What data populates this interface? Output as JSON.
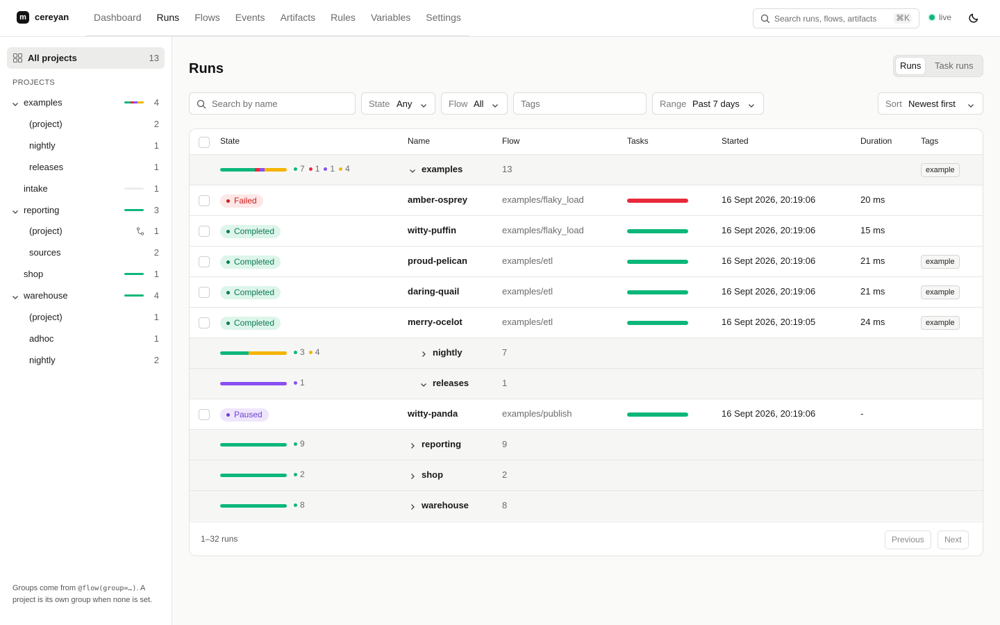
{
  "header": {
    "logo_glyph": "m",
    "brand": "cereyan",
    "nav": [
      {
        "label": "Dashboard"
      },
      {
        "label": "Runs",
        "active": true
      },
      {
        "label": "Flows"
      },
      {
        "label": "Events"
      },
      {
        "label": "Artifacts"
      },
      {
        "label": "Rules"
      },
      {
        "label": "Variables"
      },
      {
        "label": "Settings"
      }
    ],
    "search_placeholder": "Search runs, flows, artifacts",
    "search_shortcut": "⌘K",
    "live_label": "live",
    "theme_icon": "moon-icon"
  },
  "sidebar": {
    "all_projects": {
      "label": "All projects",
      "count": "13",
      "icon": "grid-icon"
    },
    "section_title": "PROJECTS",
    "tree": [
      {
        "id": "examples",
        "name": "examples",
        "count": "4",
        "level": 0,
        "expanded": true,
        "mini_bar": [
          {
            "color": "#0cb77a",
            "w": 9
          },
          {
            "color": "#e8293a",
            "w": 5
          },
          {
            "color": "#8a4ff0",
            "w": 5
          },
          {
            "color": "#f5b400",
            "w": 9
          }
        ]
      },
      {
        "id": "examples-project",
        "name": "(project)",
        "count": "2",
        "level": 1
      },
      {
        "id": "examples-nightly",
        "name": "nightly",
        "count": "1",
        "level": 1
      },
      {
        "id": "examples-releases",
        "name": "releases",
        "count": "1",
        "level": 1
      },
      {
        "id": "intake",
        "name": "intake",
        "count": "1",
        "level": 0,
        "mini_bar": [
          {
            "color": "#ececec",
            "w": 28
          }
        ]
      },
      {
        "id": "reporting",
        "name": "reporting",
        "count": "3",
        "level": 0,
        "expanded": true,
        "mini_bar": [
          {
            "color": "#0cb77a",
            "w": 28
          }
        ]
      },
      {
        "id": "reporting-project",
        "name": "(project)",
        "count": "1",
        "level": 1,
        "icon": "git-branch-icon"
      },
      {
        "id": "reporting-sources",
        "name": "sources",
        "count": "2",
        "level": 1
      },
      {
        "id": "shop",
        "name": "shop",
        "count": "1",
        "level": 0,
        "mini_bar": [
          {
            "color": "#0cb77a",
            "w": 28
          }
        ]
      },
      {
        "id": "warehouse",
        "name": "warehouse",
        "count": "4",
        "level": 0,
        "expanded": true,
        "mini_bar": [
          {
            "color": "#0cb77a",
            "w": 28
          }
        ]
      },
      {
        "id": "warehouse-project",
        "name": "(project)",
        "count": "1",
        "level": 1
      },
      {
        "id": "warehouse-adhoc",
        "name": "adhoc",
        "count": "1",
        "level": 1
      },
      {
        "id": "warehouse-nightly",
        "name": "nightly",
        "count": "2",
        "level": 1
      }
    ],
    "footer_pre": "Groups come from ",
    "footer_code": "@flow(group=…)",
    "footer_post": ". A project is its own group when none is set."
  },
  "main": {
    "title": "Runs",
    "view_toggle": [
      {
        "label": "Runs",
        "active": true
      },
      {
        "label": "Task runs"
      }
    ],
    "filters": {
      "search_placeholder": "Search by name",
      "state_label": "State",
      "state_value": "Any",
      "flow_label": "Flow",
      "flow_value": "All",
      "tags_placeholder": "Tags",
      "range_label": "Range",
      "range_value": "Past 7 days",
      "sort_label": "Sort",
      "sort_value": "Newest first"
    },
    "table": {
      "headers": {
        "state": "State",
        "name": "Name",
        "flow": "Flow",
        "tasks": "Tasks",
        "started": "Started",
        "duration": "Duration",
        "tags": "Tags"
      },
      "rows": [
        {
          "type": "group",
          "level": 0,
          "expanded": true,
          "name": "examples",
          "count": "13",
          "tag": "example",
          "bar": [
            {
              "color": "#0cb77a",
              "w": 50
            },
            {
              "color": "#e8293a",
              "w": 7
            },
            {
              "color": "#8a4ff0",
              "w": 7
            },
            {
              "color": "#f5b400",
              "w": 32
            }
          ],
          "stats": [
            {
              "color": "#0cb77a",
              "n": "7"
            },
            {
              "color": "#e8293a",
              "n": "1"
            },
            {
              "color": "#8a4ff0",
              "n": "1"
            },
            {
              "color": "#f5b400",
              "n": "4"
            }
          ]
        },
        {
          "type": "run",
          "state": "Failed",
          "state_kind": "failed",
          "name": "amber-osprey",
          "flow": "examples/flaky_load",
          "task_color": "#e8293a",
          "started": "16 Sept 2026, 20:19:06",
          "duration": "20 ms",
          "tag": ""
        },
        {
          "type": "run",
          "state": "Completed",
          "state_kind": "completed",
          "name": "witty-puffin",
          "flow": "examples/flaky_load",
          "task_color": "#0cb77a",
          "started": "16 Sept 2026, 20:19:06",
          "duration": "15 ms",
          "tag": ""
        },
        {
          "type": "run",
          "state": "Completed",
          "state_kind": "completed",
          "name": "proud-pelican",
          "flow": "examples/etl",
          "task_color": "#0cb77a",
          "started": "16 Sept 2026, 20:19:06",
          "duration": "21 ms",
          "tag": "example"
        },
        {
          "type": "run",
          "state": "Completed",
          "state_kind": "completed",
          "name": "daring-quail",
          "flow": "examples/etl",
          "task_color": "#0cb77a",
          "started": "16 Sept 2026, 20:19:06",
          "duration": "21 ms",
          "tag": "example"
        },
        {
          "type": "run",
          "state": "Completed",
          "state_kind": "completed",
          "name": "merry-ocelot",
          "flow": "examples/etl",
          "task_color": "#0cb77a",
          "started": "16 Sept 2026, 20:19:05",
          "duration": "24 ms",
          "tag": "example"
        },
        {
          "type": "group",
          "level": 1,
          "expanded": false,
          "name": "nightly",
          "count": "7",
          "tag": "",
          "bar": [
            {
              "color": "#0cb77a",
              "w": 41
            },
            {
              "color": "#f5b400",
              "w": 55
            }
          ],
          "stats": [
            {
              "color": "#0cb77a",
              "n": "3"
            },
            {
              "color": "#f5b400",
              "n": "4"
            }
          ]
        },
        {
          "type": "group",
          "level": 1,
          "expanded": true,
          "name": "releases",
          "count": "1",
          "tag": "",
          "bar": [
            {
              "color": "#8a4ff0",
              "w": 96
            }
          ],
          "stats": [
            {
              "color": "#8a4ff0",
              "n": "1"
            }
          ]
        },
        {
          "type": "run",
          "state": "Paused",
          "state_kind": "paused",
          "name": "witty-panda",
          "flow": "examples/publish",
          "task_color": "#0cb77a",
          "started": "16 Sept 2026, 20:19:06",
          "duration": "-",
          "tag": ""
        },
        {
          "type": "group",
          "level": 0,
          "expanded": false,
          "name": "reporting",
          "count": "9",
          "tag": "",
          "bar": [
            {
              "color": "#0cb77a",
              "w": 96
            }
          ],
          "stats": [
            {
              "color": "#0cb77a",
              "n": "9"
            }
          ]
        },
        {
          "type": "group",
          "level": 0,
          "expanded": false,
          "name": "shop",
          "count": "2",
          "tag": "",
          "bar": [
            {
              "color": "#0cb77a",
              "w": 96
            }
          ],
          "stats": [
            {
              "color": "#0cb77a",
              "n": "2"
            }
          ]
        },
        {
          "type": "group",
          "level": 0,
          "expanded": false,
          "name": "warehouse",
          "count": "8",
          "tag": "",
          "bar": [
            {
              "color": "#0cb77a",
              "w": 96
            }
          ],
          "stats": [
            {
              "color": "#0cb77a",
              "n": "8"
            }
          ]
        }
      ]
    },
    "pagination": {
      "summary": "1–32 runs",
      "prev": "Previous",
      "next": "Next"
    }
  }
}
